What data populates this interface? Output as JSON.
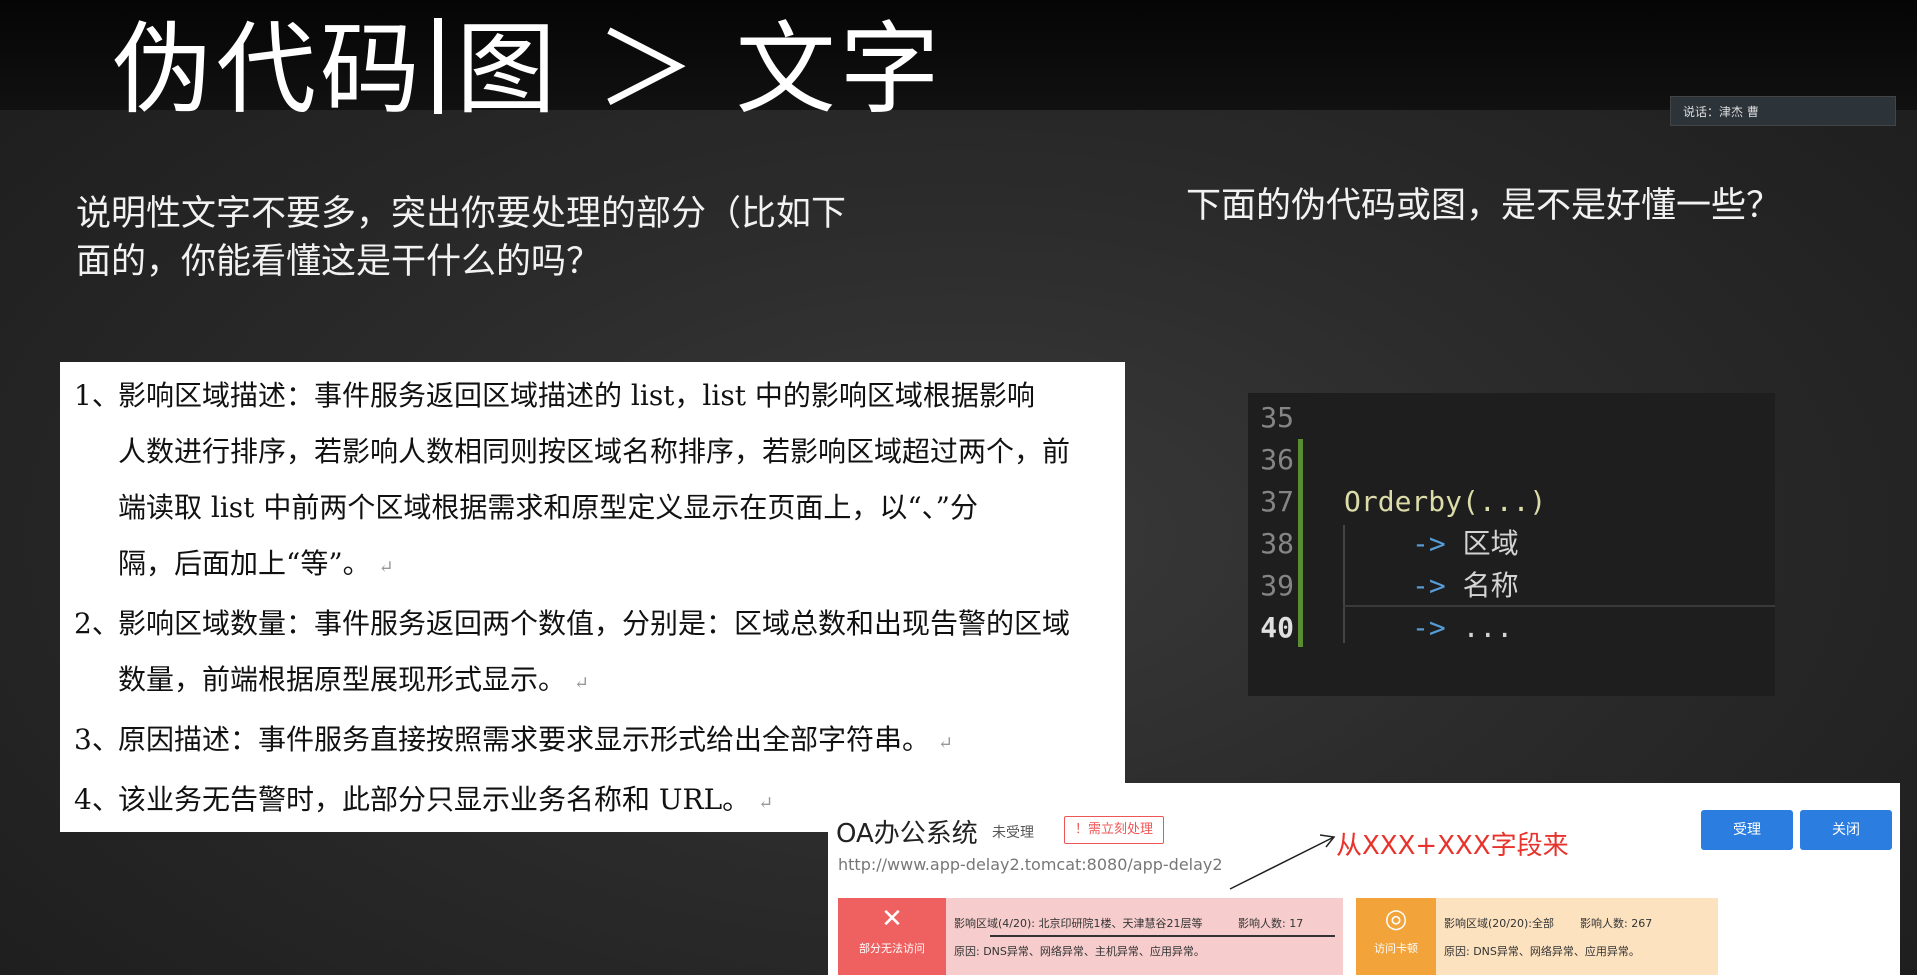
{
  "header": {
    "title_left": "伪代码",
    "title_right": "图 ＞ 文字"
  },
  "speaker": {
    "label": "说话：津杰 曹"
  },
  "left_caption": {
    "line1": "说明性文字不要多，突出你要处理的部分（比如下",
    "line2": "面的，你能看懂这是干什么的吗？"
  },
  "right_caption": "下面的伪代码或图，是不是好懂一些？",
  "document": {
    "items": [
      {
        "num": "1、",
        "lines": [
          "影响区域描述：事件服务返回区域描述的 list，list 中的影响区域根据影响",
          "人数进行排序，若影响人数相同则按区域名称排序，若影响区域超过两个，前",
          "端读取 list 中前两个区域根据需求和原型定义显示在页面上，以“、”分",
          "隔，后面加上“等”。"
        ]
      },
      {
        "num": "2、",
        "lines": [
          "影响区域数量：事件服务返回两个数值，分别是：区域总数和出现告警的区域",
          "数量，前端根据原型展现形式显示。"
        ]
      },
      {
        "num": "3、",
        "lines": [
          "原因描述：事件服务直接按照需求要求显示形式给出全部字符串。"
        ]
      },
      {
        "num": "4、",
        "lines": [
          "该业务无告警时，此部分只显示业务名称和 URL。"
        ]
      }
    ],
    "paragraph_mark": "↵"
  },
  "code": {
    "line_numbers": [
      "35",
      "36",
      "37",
      "38",
      "39",
      "40"
    ],
    "active_line": "40",
    "lines": {
      "l37": "Orderby(...)",
      "l38_arrow": "->",
      "l38_text": "区域",
      "l39_arrow": "->",
      "l39_text": "名称",
      "l40_arrow": "->",
      "l40_text": "..."
    },
    "colors": {
      "background": "#1e1e1e",
      "function": "#dcdcaa",
      "arrow": "#569cd6",
      "gutter_bar": "#5a8c32"
    }
  },
  "oa": {
    "title": "OA办公系统",
    "status": "未受理",
    "badge": "！需立刻处理",
    "url": "http://www.app-delay2.tomcat:8080/app-delay2",
    "annotation": "从XXX+XXX字段来",
    "accept_label": "受理",
    "close_label": "关闭",
    "card_red": {
      "icon_label": "部分无法访问",
      "area_line": "影响区域(4/20): 北京印研院1楼、天津慧谷21层等",
      "people": "影响人数: 17",
      "reason": "原因: DNS异常、网络异常、主机异常、应用异常。"
    },
    "card_orange": {
      "icon_label": "访问卡顿",
      "area_line": "影响区域(20/20):全部",
      "people": "影响人数: 267",
      "reason": "原因: DNS异常、网络异常、应用异常。"
    },
    "colors": {
      "button": "#2b7de0",
      "red": "#ef6161",
      "orange": "#f2a33a",
      "annotation": "#e8332c"
    }
  }
}
